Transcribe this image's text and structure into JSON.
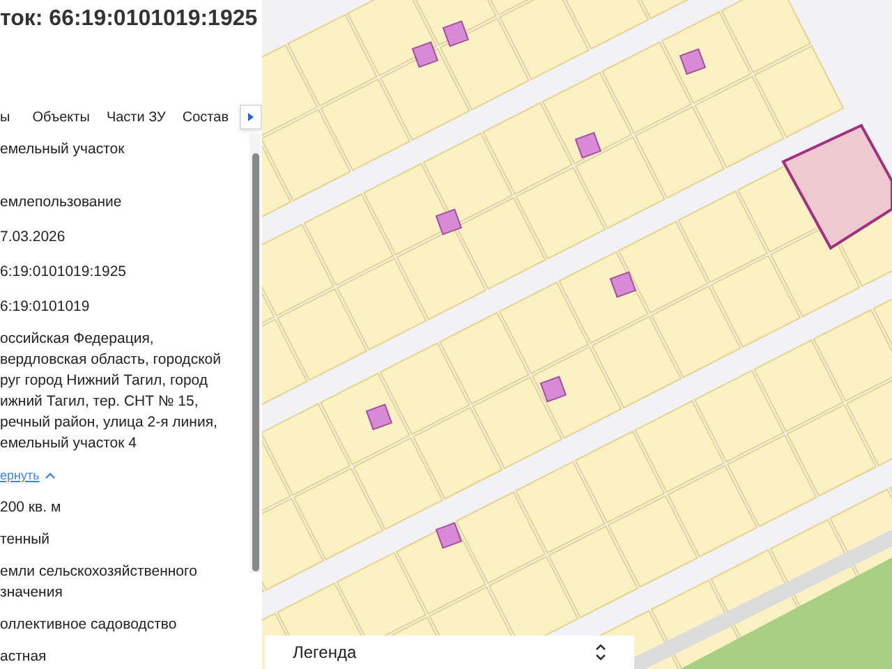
{
  "panel": {
    "title": "ток: 66:19:0101019:1925",
    "tabs": [
      {
        "label": "ы"
      },
      {
        "label": "Объекты"
      },
      {
        "label": "Части ЗУ"
      },
      {
        "label": "Состав"
      }
    ],
    "fields": [
      {
        "kind": "text",
        "lines": [
          "емельный участок"
        ]
      },
      {
        "kind": "text",
        "lines": [
          "емлепользование"
        ]
      },
      {
        "kind": "text",
        "lines": [
          "7.03.2026"
        ]
      },
      {
        "kind": "text",
        "lines": [
          "6:19:0101019:1925"
        ]
      },
      {
        "kind": "text",
        "lines": [
          "6:19:0101019"
        ]
      },
      {
        "kind": "text",
        "lines": [
          "оссийская Федерация,",
          "вердловская область, городской",
          "руг город Нижний Тагил, город",
          "ижний Тагил, тер. СНТ № 15,",
          "речный район, улица 2-я линия,",
          "емельный участок 4"
        ]
      },
      {
        "kind": "link",
        "lines": [
          "ернуть"
        ]
      },
      {
        "kind": "text",
        "lines": [
          "200 кв. м"
        ]
      },
      {
        "kind": "text",
        "lines": [
          "тенный"
        ]
      },
      {
        "kind": "text",
        "lines": [
          "емли сельскохозяйственного",
          "значения"
        ]
      },
      {
        "kind": "text",
        "lines": [
          "оллективное садоводство"
        ]
      },
      {
        "kind": "text",
        "lines": [
          "астная"
        ]
      }
    ]
  },
  "legend": {
    "title": "Легенда"
  }
}
